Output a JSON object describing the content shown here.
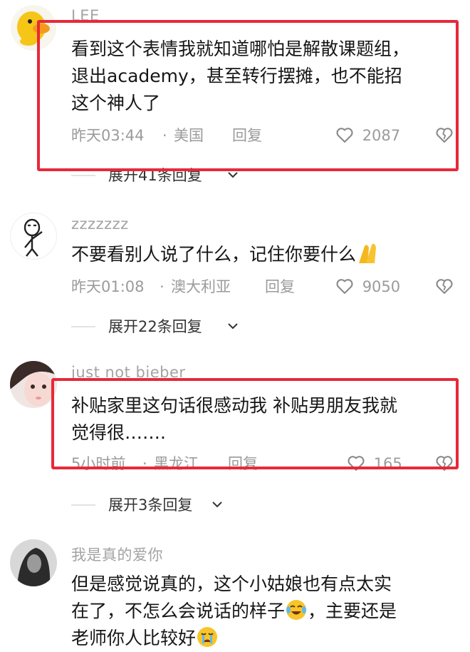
{
  "comments": [
    {
      "username": "LEE",
      "lines": [
        "看到这个表情我就知道哪怕是解散课题组，",
        "退出academy，甚至转行摆摊，也不能招",
        "这个神人了"
      ],
      "time": "昨天03:44",
      "location": "美国",
      "reply_label": "回复",
      "likes": "2087",
      "expand_label": "展开41条回复"
    },
    {
      "username": "zzzzzzz",
      "lines": [
        "不要看别人说了什么，记住你要什么"
      ],
      "time": "昨天01:08",
      "location": "澳大利亚",
      "reply_label": "回复",
      "likes": "9050",
      "expand_label": "展开22条回复"
    },
    {
      "username": "just not bieber",
      "lines": [
        "补贴家里这句话很感动我 补贴男朋友我就",
        "觉得很……."
      ],
      "time": "5小时前",
      "location": "黑龙江",
      "reply_label": "回复",
      "likes": "165",
      "expand_label": "展开3条回复"
    },
    {
      "username": "我是真的爱你",
      "lines": [
        "但是感觉说真的，这个小姑娘也有点太实",
        "在了，不怎么会说话的样子",
        "，主要还是",
        "老师你人比较好"
      ]
    }
  ],
  "separator": "·",
  "colors": {
    "highlight_box": "#e8283a",
    "meta_text": "#9b9b9b",
    "body_text": "#161616"
  },
  "icons": [
    "avatar-duck",
    "avatar-stickman",
    "avatar-girl",
    "avatar-dark",
    "heart-icon",
    "broken-heart-icon",
    "chevron-down-icon",
    "clapping-hands-emoji",
    "laughing-crying-emoji",
    "crying-emoji"
  ]
}
